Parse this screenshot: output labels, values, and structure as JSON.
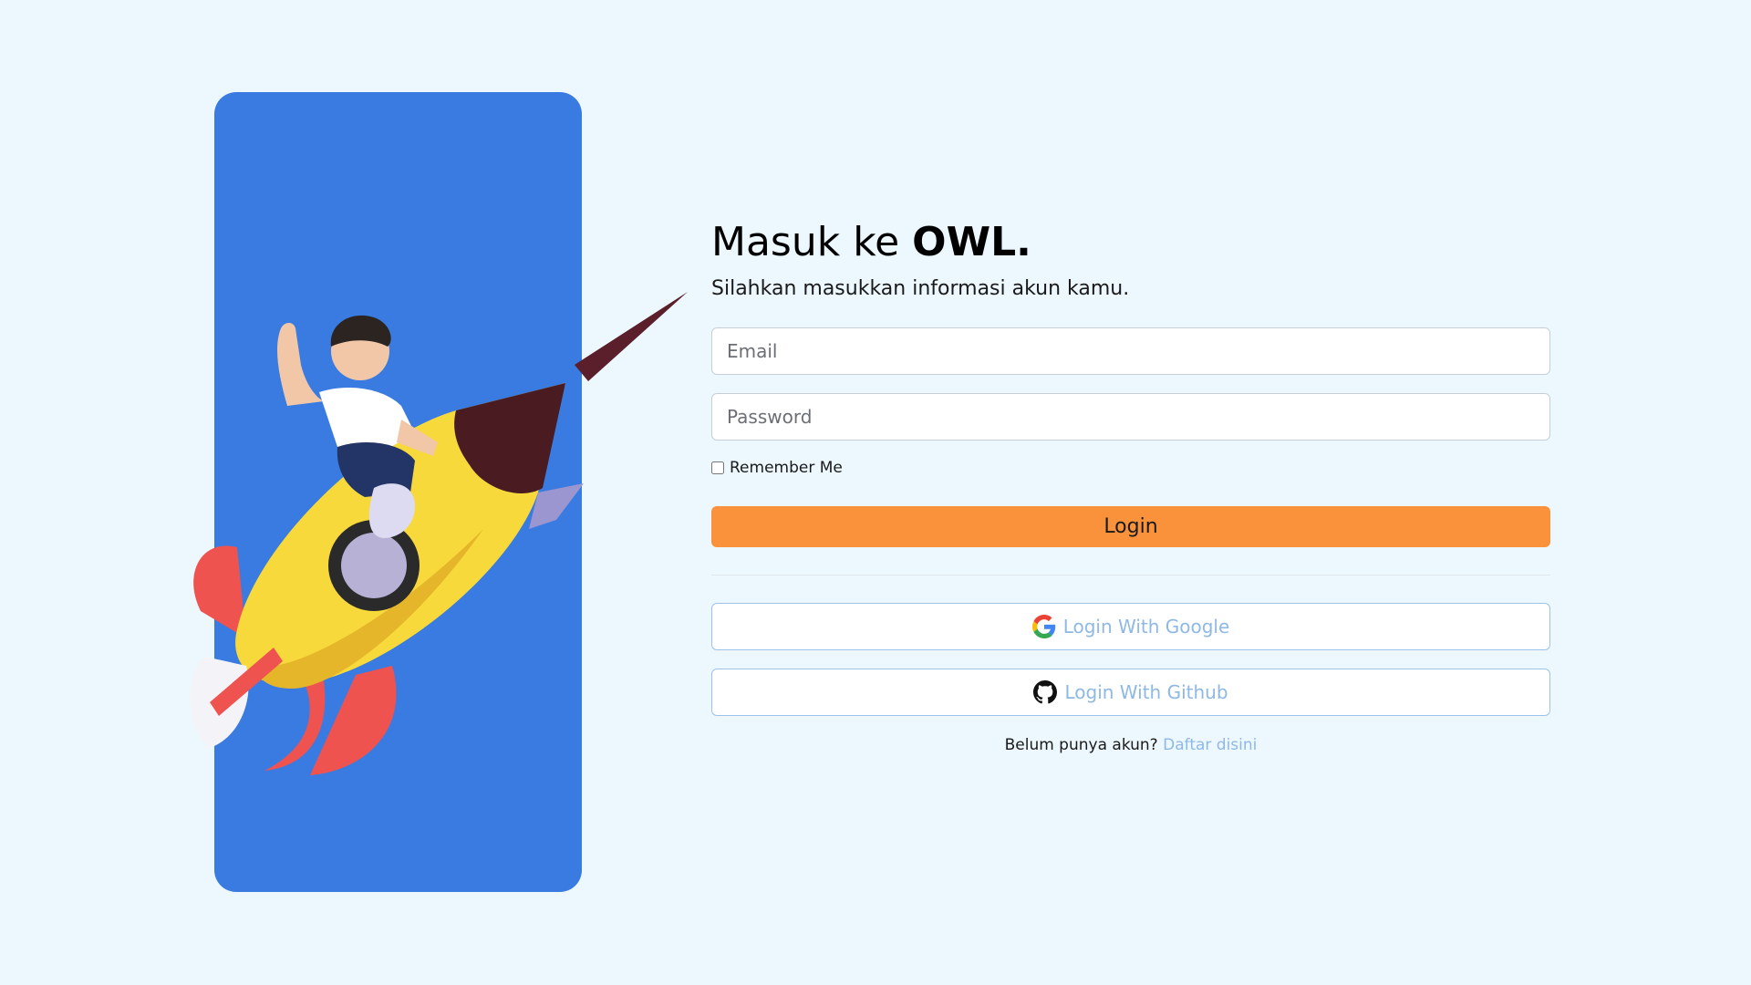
{
  "heading": {
    "prefix": "Masuk ke ",
    "brand": "OWL."
  },
  "subtitle": "Silahkan masukkan informasi akun kamu.",
  "form": {
    "email_placeholder": "Email",
    "password_placeholder": "Password",
    "remember_label": "Remember Me",
    "login_label": "Login"
  },
  "oauth": {
    "google_label": "Login With Google",
    "github_label": "Login With Github"
  },
  "signup": {
    "prompt": "Belum punya akun?",
    "link_label": "Daftar disini"
  },
  "colors": {
    "background": "#edf8fe",
    "panel": "#397be0",
    "login_button": "#f9923a",
    "link": "#8eb8e6"
  },
  "icons": {
    "google": "google-icon",
    "github": "github-icon",
    "illustration": "rocket-rider-illustration"
  }
}
